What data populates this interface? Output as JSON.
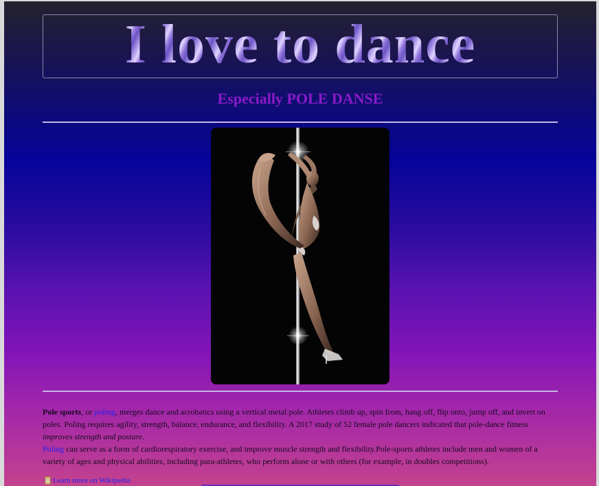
{
  "header": {
    "title": "I love to dance",
    "subtitle": "Especially POLE DANSE"
  },
  "image": {
    "icon": "pole-dancer-photo"
  },
  "article": {
    "p1_term": "Pole sports",
    "p1_a": ", or ",
    "p1_link": "poling",
    "p1_b": ", merges dance and acrobatics using a vertical metal pole. Athletes climb up, spin from, hang off, flip onto, jump off, and invert on poles. Poling requires agility, strength, balance, endurance, and flexibility. A 2017 study of 52 female pole dancers indicated that pole-dance fitness ",
    "p1_em": "improves strength and posture",
    "p1_c": ".",
    "p2_link": "Poling",
    "p2_text": " can serve as a form of cardiorespiratory exercise, and improve muscle strength and flexibility.Pole-sports athletes include men and women of a variety of ages and physical abilities, including para-athletes, who perform alone or with others (for example, in doubles competitions)."
  },
  "footer": {
    "wiki_link": "Learn more on Wikipedia",
    "wiki_icon": "scroll-icon"
  },
  "colors": {
    "subtitle": "#8a1ac8",
    "link": "#2222ee",
    "rule": "#c6b8e6"
  }
}
